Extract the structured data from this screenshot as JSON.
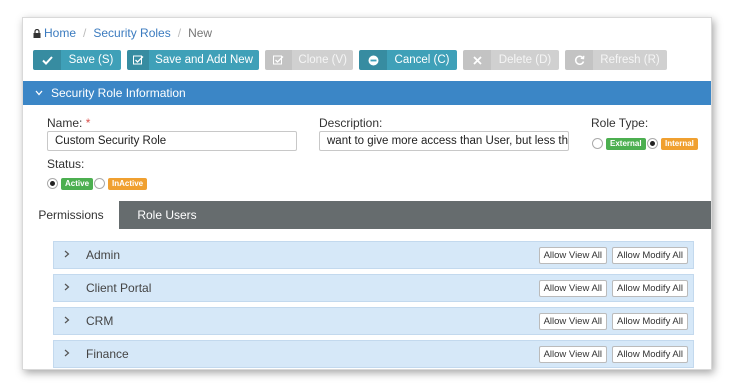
{
  "breadcrumb": {
    "home": "Home",
    "section": "Security Roles",
    "current": "New",
    "separator": "/"
  },
  "toolbar": {
    "save": "Save (S)",
    "save_add_new": "Save and Add New",
    "clone": "Clone (V)",
    "cancel": "Cancel (C)",
    "delete": "Delete (D)",
    "refresh": "Refresh (R)"
  },
  "section": {
    "title": "Security Role Information"
  },
  "form": {
    "name_label": "Name:",
    "required_mark": "*",
    "name_value": "Custom Security Role",
    "description_label": "Description:",
    "description_value": "want to give more access than User, but less the PM",
    "role_type_label": "Role Type:",
    "role_type_options": [
      "External",
      "Internal"
    ],
    "role_type_selected": "Internal",
    "status_label": "Status:",
    "status_options": [
      "Active",
      "InActive"
    ],
    "status_selected": "Active"
  },
  "tabs": [
    "Permissions",
    "Role Users"
  ],
  "permissions": {
    "allow_view_label": "Allow View All",
    "allow_modify_label": "Allow Modify All",
    "groups": [
      "Admin",
      "Client Portal",
      "CRM",
      "Finance"
    ]
  },
  "colors": {
    "primary_button": "#3fa0b8",
    "section_header": "#3b86c6",
    "tab_bar": "#666c6e",
    "row_bg": "#d6e8f8",
    "badge_green": "#4caf50",
    "badge_orange": "#f0a030"
  }
}
